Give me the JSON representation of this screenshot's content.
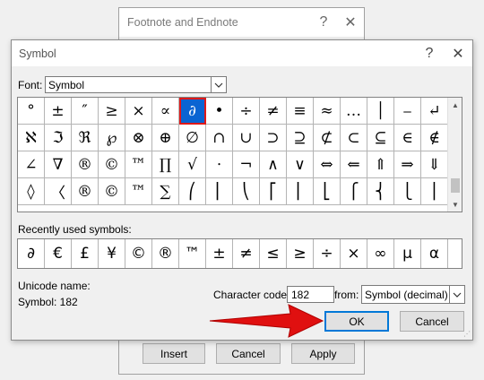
{
  "background_dialog": {
    "title": "Footnote and Endnote",
    "help": "?",
    "close": "✕",
    "buttons": [
      "Insert",
      "Cancel",
      "Apply"
    ]
  },
  "dialog": {
    "title": "Symbol",
    "help": "?",
    "close": "✕",
    "font_label": "Font:",
    "font_value": "Symbol",
    "grid": [
      [
        "°",
        "±",
        "″",
        "≥",
        "×",
        "∝",
        "∂",
        "•",
        "÷",
        "≠",
        "≡",
        "≈",
        "…",
        "│",
        "⎯",
        "↵"
      ],
      [
        "ℵ",
        "ℑ",
        "ℜ",
        "℘",
        "⊗",
        "⊕",
        "∅",
        "∩",
        "∪",
        "⊃",
        "⊇",
        "⊄",
        "⊂",
        "⊆",
        "∈",
        "∉"
      ],
      [
        "∠",
        "∇",
        "®",
        "©",
        "™",
        "∏",
        "√",
        "⋅",
        "¬",
        "∧",
        "∨",
        "⇔",
        "⇐",
        "⇑",
        "⇒",
        "⇓"
      ],
      [
        "◊",
        "〈",
        "®",
        "©",
        "™",
        "∑",
        "⎛",
        "⎜",
        "⎝",
        "⎡",
        "⎢",
        "⎣",
        "⎧",
        "⎨",
        "⎩",
        "⎪"
      ]
    ],
    "selected_symbol": "∂",
    "recent_label": "Recently used symbols:",
    "recent": [
      "∂",
      "€",
      "£",
      "¥",
      "©",
      "®",
      "™",
      "±",
      "≠",
      "≤",
      "≥",
      "÷",
      "×",
      "∞",
      "µ",
      "α"
    ],
    "unicode_name_label": "Unicode name:",
    "unicode_name_value": "Symbol: 182",
    "char_code_label": "Character code:",
    "char_code_value": "182",
    "from_label": "from:",
    "from_value": "Symbol (decimal)",
    "ok": "OK",
    "cancel": "Cancel",
    "arrow_color": "#e01010"
  }
}
